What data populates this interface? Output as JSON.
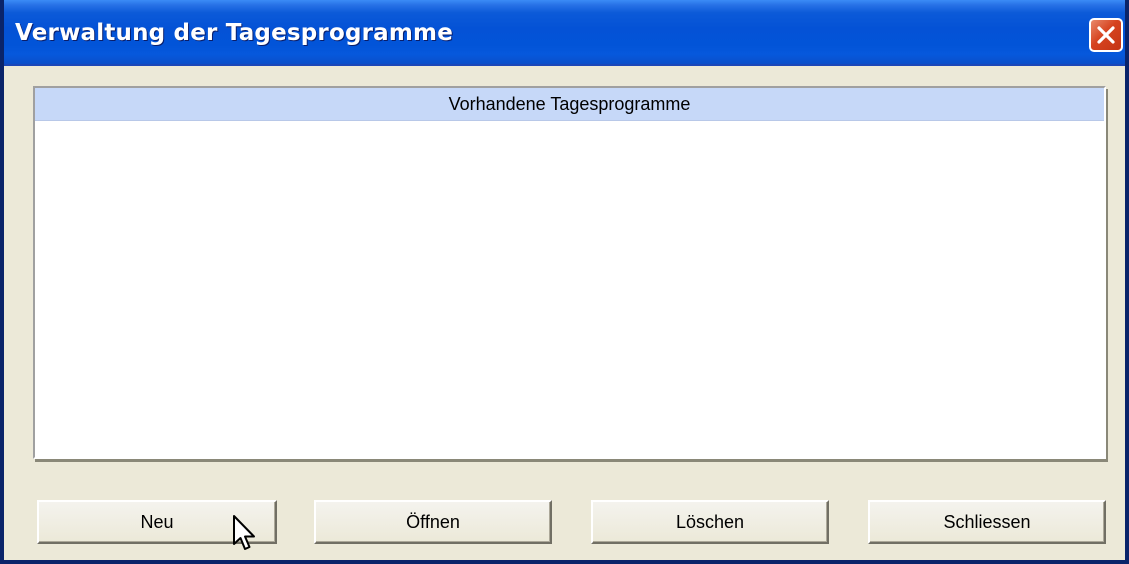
{
  "window": {
    "title": "Verwaltung der Tagesprogramme",
    "close_icon": "close-icon"
  },
  "list": {
    "header": "Vorhandene Tagesprogramme",
    "items": []
  },
  "buttons": {
    "neu": "Neu",
    "oeffnen": "Öffnen",
    "loeschen": "Löschen",
    "schliessen": "Schliessen"
  },
  "colors": {
    "titlebar": "#0452d6",
    "close_button": "#d6431f",
    "dialog_background": "#ece9d8",
    "list_header": "#c6d8f8"
  },
  "cursor_icon": "mouse-pointer-icon"
}
